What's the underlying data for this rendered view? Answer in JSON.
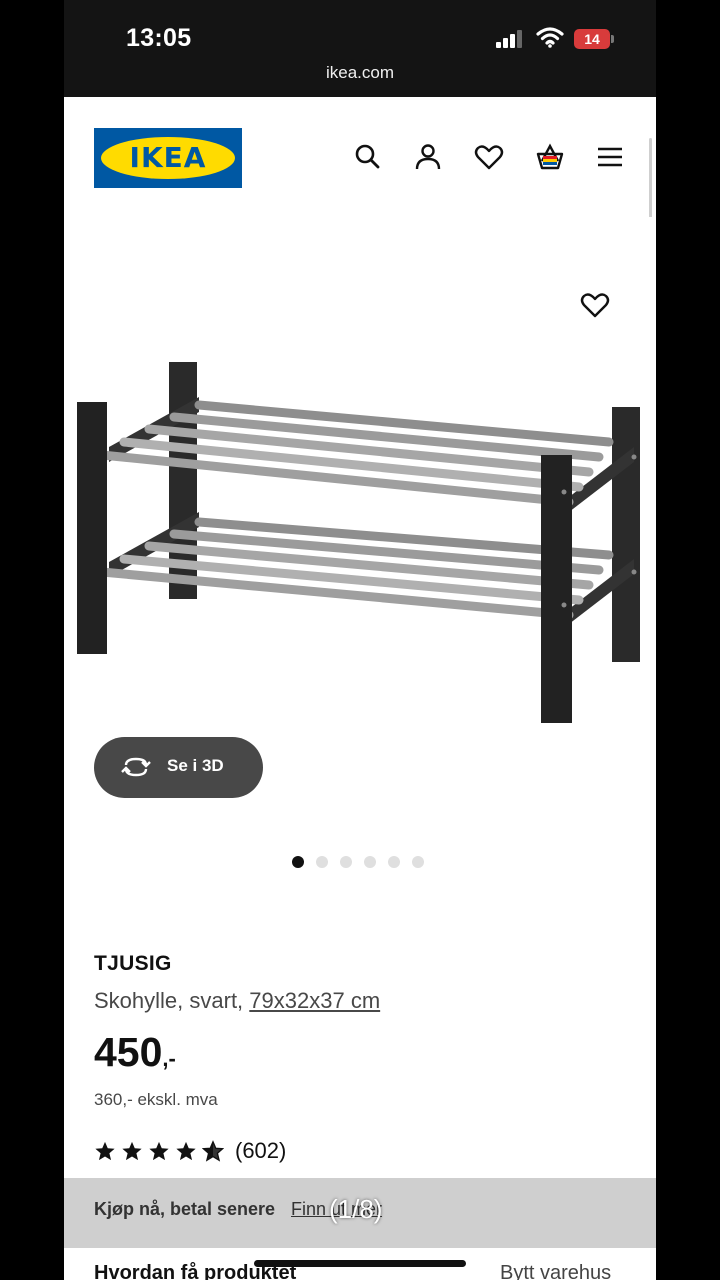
{
  "status_bar": {
    "time": "13:05",
    "battery": "14",
    "url": "ikea.com"
  },
  "header": {
    "logo_text": "IKEA"
  },
  "gallery": {
    "button_3d_label": "Se i 3D",
    "dot_count": 6,
    "active_dot": 1
  },
  "product": {
    "name": "TJUSIG",
    "description": "Skohylle, svart,",
    "size": "79x32x37 cm",
    "price": "450",
    "price_suffix": ",-",
    "price_ex_vat": "360,- ekskl. mva",
    "rating": 4.5,
    "rating_count": "(602)"
  },
  "banner": {
    "text": "Kjøp nå, betal senere",
    "link": "Finn ut mer",
    "image_counter": "(1/8)"
  },
  "delivery": {
    "title": "Hvordan få produktet",
    "change_store": "Bytt varehus"
  },
  "colors": {
    "ikea_blue": "#0058a3",
    "ikea_yellow": "#ffdb00",
    "battery_red": "#d83b3b",
    "button_grey": "#484848"
  }
}
